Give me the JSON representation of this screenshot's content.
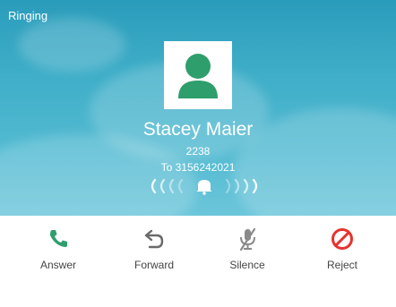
{
  "call": {
    "status": "Ringing",
    "caller_name": "Stacey Maier",
    "caller_number": "2238",
    "callee_line": "To 3156242021"
  },
  "actions": [
    {
      "label": "Answer",
      "icon": "phone-icon",
      "color": "#2e9e6c"
    },
    {
      "label": "Forward",
      "icon": "forward-arrow-icon",
      "color": "#6a6a6a"
    },
    {
      "label": "Silence",
      "icon": "mute-mic-icon",
      "color": "#8a8a8a"
    },
    {
      "label": "Reject",
      "icon": "reject-icon",
      "color": "#e8322d"
    }
  ],
  "colors": {
    "avatar_green": "#2e9e6c",
    "background_blue": "#3aa9c4"
  }
}
